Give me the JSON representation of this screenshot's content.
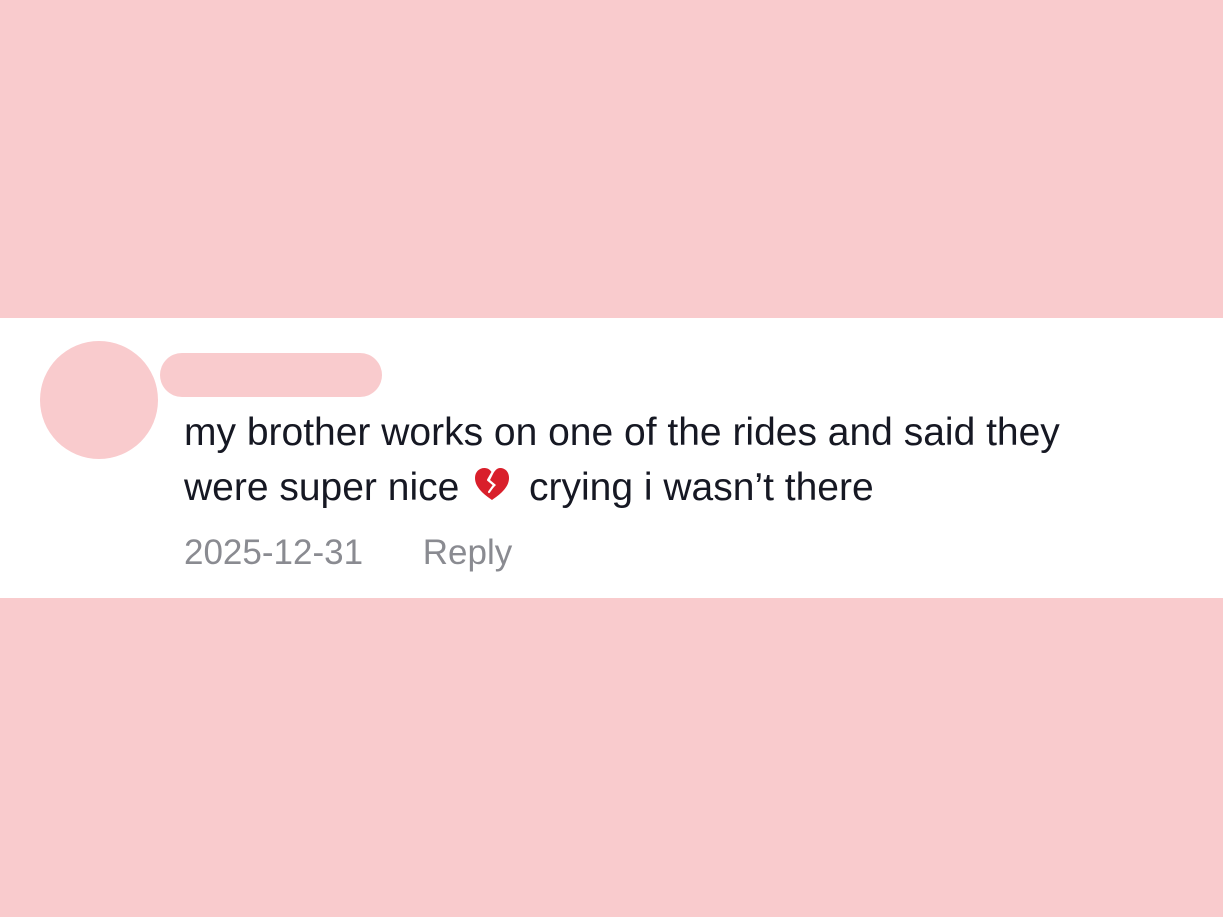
{
  "comment": {
    "text_line_1": "my brother works on one of the rides and said they",
    "text_line_2_before_emoji": "were super nice",
    "text_line_2_after_emoji": "crying i wasn’t there",
    "emoji_icon": "broken-heart-icon",
    "date": "2025-12-31",
    "reply_label": "Reply"
  },
  "colors": {
    "background_pink": "#f9cbcd",
    "comment_text": "#161823",
    "meta_text": "#8a8b91",
    "card_background": "#ffffff"
  }
}
